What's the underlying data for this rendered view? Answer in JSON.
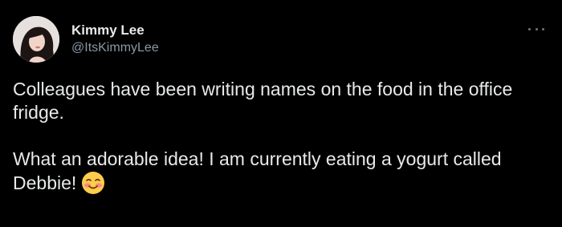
{
  "tweet": {
    "author": {
      "display_name": "Kimmy Lee",
      "handle": "@ItsKimmyLee",
      "avatar_icon": "avatar"
    },
    "more_icon": "more-options-icon",
    "text": {
      "line_group_1": "Colleagues have been writing names on the food in the office fridge.",
      "line_group_2": "What an adorable idea! I am currently eating a yogurt called Debbie!",
      "emoji": "smiling-face-with-blushing-cheeks-icon"
    }
  },
  "colors": {
    "background": "#000000",
    "primary_text": "#e7e9ea",
    "secondary_text": "#8b98a5",
    "muted_icon": "#6e767d"
  }
}
